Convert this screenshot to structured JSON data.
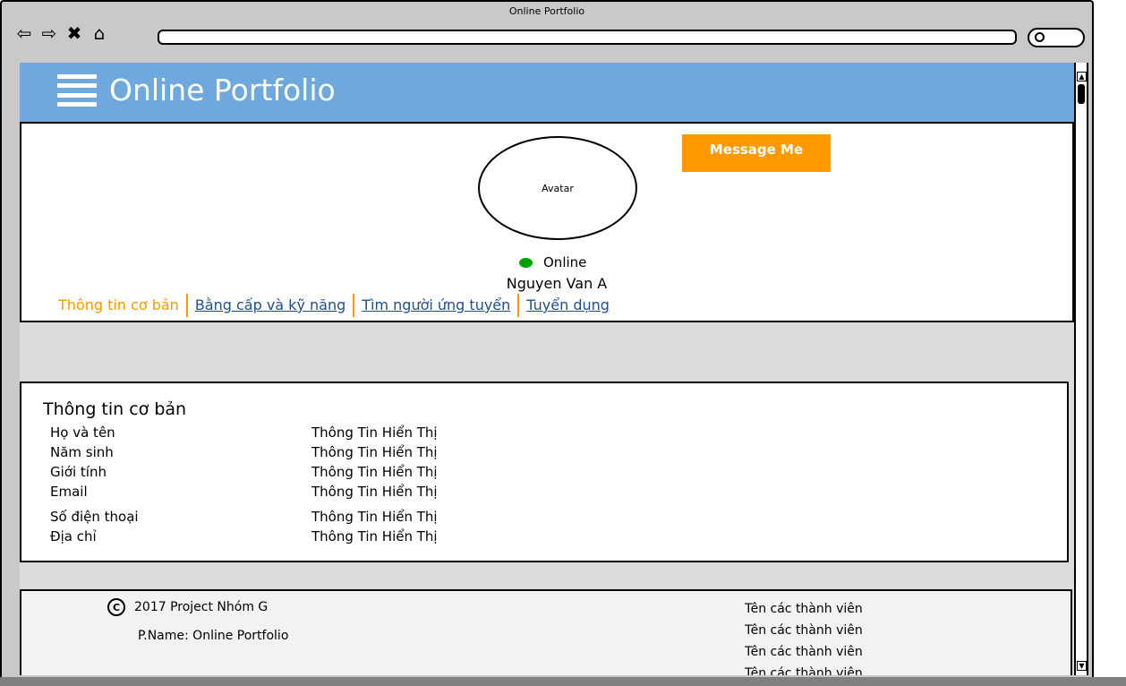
{
  "window": {
    "title": "Online Portfolio"
  },
  "header": {
    "title": "Online Portfolio"
  },
  "profile": {
    "message_button": "Message Me",
    "avatar_label": "Avatar",
    "status": "Online",
    "status_color": "#00a000",
    "name": "Nguyen Van A"
  },
  "tabs": [
    {
      "label": "Thông tin cơ bản",
      "active": true
    },
    {
      "label": "Bằng cấp và kỹ năng",
      "active": false
    },
    {
      "label": "Tìm người ứng tuyển",
      "active": false
    },
    {
      "label": "Tuyển dụng",
      "active": false
    }
  ],
  "basic_info": {
    "title": "Thông tin cơ bản",
    "rows": [
      {
        "label": "Họ và tên",
        "value": "Thông Tin Hiển Thị"
      },
      {
        "label": "Năm sinh",
        "value": "Thông Tin Hiển Thị"
      },
      {
        "label": "Giới tính",
        "value": "Thông Tin Hiển Thị"
      },
      {
        "label": "Email",
        "value": "Thông Tin Hiển Thị"
      },
      {
        "label": "Số điện thoại",
        "value": "Thông Tin Hiển Thị"
      },
      {
        "label": "Địa chỉ",
        "value": "Thông Tin Hiển Thị"
      }
    ]
  },
  "footer": {
    "copyright": "2017 Project Nhóm G",
    "pname": "P.Name: Online Portfolio",
    "members": [
      "Tên các thành viên",
      "Tên các thành viên",
      "Tên các thành viên",
      "Tên các thành viên"
    ]
  },
  "colors": {
    "header": "#6ea8dc",
    "accent": "#ff9900",
    "link": "#1f4f8f"
  }
}
